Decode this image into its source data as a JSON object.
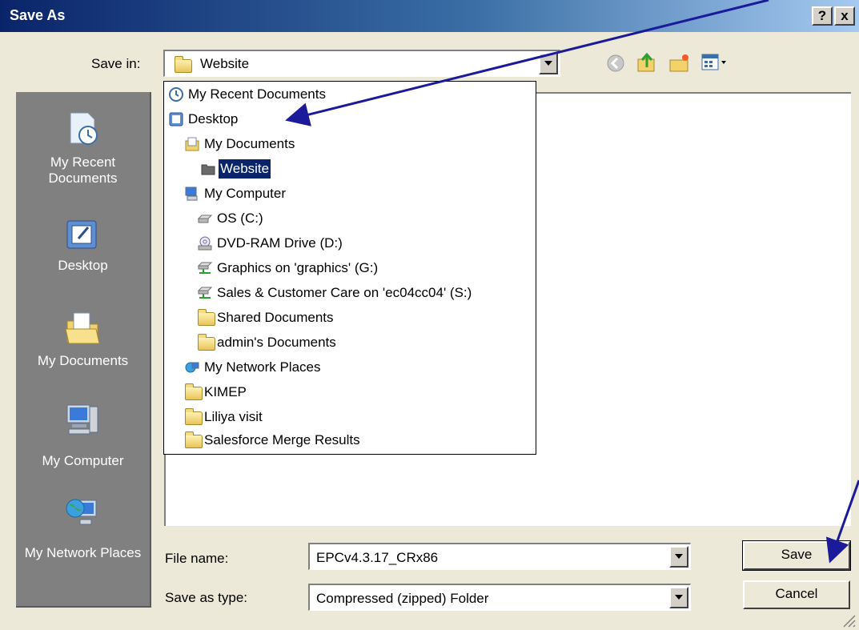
{
  "window": {
    "title": "Save As",
    "help_label": "?",
    "close_label": "x"
  },
  "save_in": {
    "label": "Save in:",
    "value": "Website"
  },
  "places": [
    {
      "label": "My Recent Documents",
      "icon": "recent-documents-icon"
    },
    {
      "label": "Desktop",
      "icon": "desktop-icon"
    },
    {
      "label": "My Documents",
      "icon": "my-documents-icon"
    },
    {
      "label": "My Computer",
      "icon": "my-computer-icon"
    },
    {
      "label": "My Network Places",
      "icon": "network-places-icon"
    }
  ],
  "dropdown": {
    "items": [
      {
        "label": "My Recent Documents",
        "icon": "recent-documents-icon",
        "level": 0
      },
      {
        "label": "Desktop",
        "icon": "desktop-icon",
        "level": 0
      },
      {
        "label": "My Documents",
        "icon": "my-documents-icon",
        "level": 1
      },
      {
        "label": "Website",
        "icon": "folder-open-icon",
        "level": 2,
        "selected": true
      },
      {
        "label": "My Computer",
        "icon": "my-computer-icon",
        "level": 1
      },
      {
        "label": "OS (C:)",
        "icon": "drive-icon",
        "level": 2
      },
      {
        "label": "DVD-RAM Drive (D:)",
        "icon": "dvd-drive-icon",
        "level": 2
      },
      {
        "label": "Graphics on 'graphics' (G:)",
        "icon": "network-drive-icon",
        "level": 2
      },
      {
        "label": "Sales & Customer Care on 'ec04cc04' (S:)",
        "icon": "network-drive-icon",
        "level": 2
      },
      {
        "label": "Shared Documents",
        "icon": "folder-icon",
        "level": 2
      },
      {
        "label": "admin's Documents",
        "icon": "folder-icon",
        "level": 2
      },
      {
        "label": "My Network Places",
        "icon": "network-places-icon",
        "level": 1
      },
      {
        "label": "KIMEP",
        "icon": "folder-icon",
        "level": 1
      },
      {
        "label": "Liliya visit",
        "icon": "folder-icon",
        "level": 1
      },
      {
        "label": "Salesforce Merge Results",
        "icon": "folder-icon",
        "level": 1
      }
    ]
  },
  "form": {
    "file_name_label": "File name:",
    "file_name_value": "EPCv4.3.17_CRx86",
    "type_label": "Save as type:",
    "type_value": "Compressed (zipped) Folder"
  },
  "buttons": {
    "save": "Save",
    "cancel": "Cancel"
  },
  "colors": {
    "title_start": "#0A246A",
    "title_end": "#A6CAF0",
    "annotation_arrow": "#1A1A9A",
    "selection": "#0A246A"
  }
}
